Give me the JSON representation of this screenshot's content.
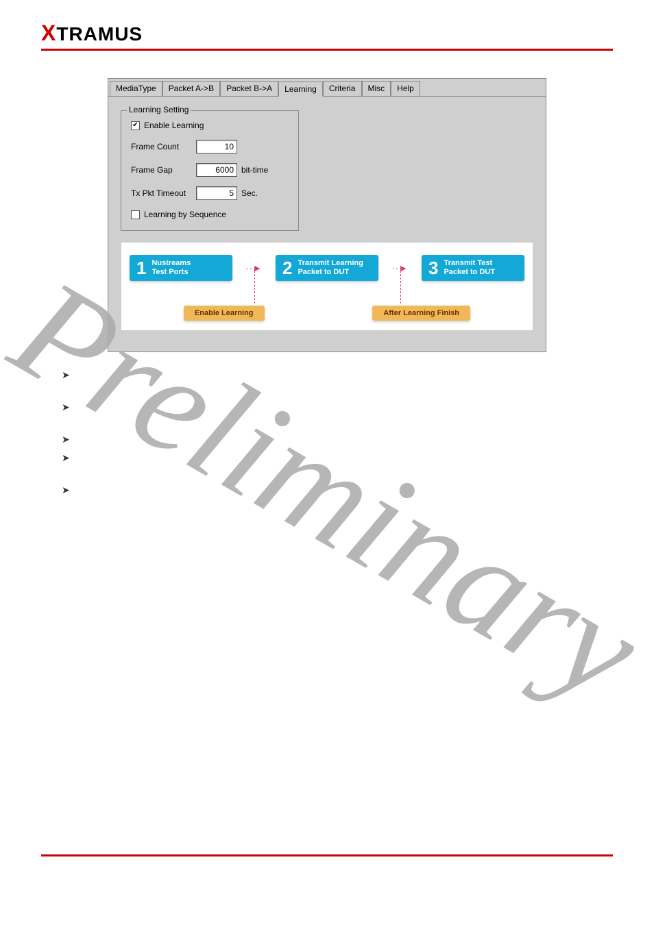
{
  "brand": {
    "logo_red": "X",
    "logo_rest": "TRAMUS"
  },
  "tabs": [
    {
      "label": "MediaType",
      "active": false
    },
    {
      "label": "Packet A->B",
      "active": false
    },
    {
      "label": "Packet B->A",
      "active": false
    },
    {
      "label": "Learning",
      "active": true
    },
    {
      "label": "Criteria",
      "active": false
    },
    {
      "label": "Misc",
      "active": false
    },
    {
      "label": "Help",
      "active": false
    }
  ],
  "learning": {
    "fieldset_title": "Learning Setting",
    "enable_label": "Enable Learning",
    "enable_checked": true,
    "frame_count_label": "Frame Count",
    "frame_count_value": "10",
    "frame_gap_label": "Frame Gap",
    "frame_gap_value": "6000",
    "frame_gap_unit": "bit-time",
    "tx_timeout_label": "Tx Pkt Timeout",
    "tx_timeout_value": "5",
    "tx_timeout_unit": "Sec.",
    "seq_label": "Learning by Sequence",
    "seq_checked": false
  },
  "diagram": {
    "steps": [
      {
        "n": "1",
        "line1": "Nustreams",
        "line2": "Test Ports"
      },
      {
        "n": "2",
        "line1": "Transmit Learning",
        "line2": "Packet to DUT"
      },
      {
        "n": "3",
        "line1": "Transmit Test",
        "line2": "Packet to DUT"
      }
    ],
    "annotations": [
      "Enable Learning",
      "After Learning Finish"
    ]
  },
  "watermark": "Preliminary"
}
